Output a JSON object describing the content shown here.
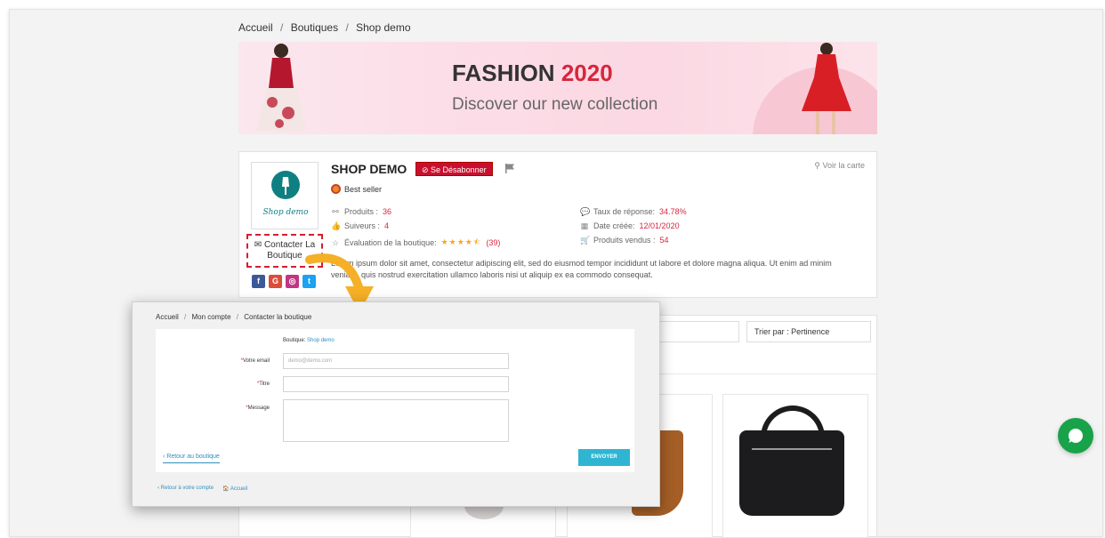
{
  "breadcrumb": {
    "items": [
      "Accueil",
      "Boutiques",
      "Shop demo"
    ],
    "separator": "/"
  },
  "banner": {
    "title": "FASHION",
    "year": "2020",
    "subtitle": "Discover our new collection"
  },
  "shop": {
    "name": "SHOP DEMO",
    "unsubscribe_label": "⊘ Se Désabonner",
    "map_link": "Voir la carte",
    "badge": "Best seller",
    "logo_text": "Shop demo",
    "contact_label_line1": "Contacter La",
    "contact_label_line2": "Boutique",
    "stats_left": [
      {
        "label": "Produits :",
        "value": "36"
      },
      {
        "label": "Suiveurs :",
        "value": "4"
      },
      {
        "label": "Évaluation de la boutique:",
        "value": "(39)"
      }
    ],
    "stats_right": [
      {
        "label": "Taux de réponse:",
        "value": "34.78%"
      },
      {
        "label": "Date créée:",
        "value": "12/01/2020"
      },
      {
        "label": "Produits vendus :",
        "value": "54"
      }
    ],
    "description": "Lorem ipsum dolor sit amet, consectetur adipiscing elit, sed do eiusmod tempor incididunt ut labore et dolore magna aliqua. Ut enim ad minim veniam, quis nostrud exercitation ullamco laboris nisi ut aliquip ex ea commodo consequat.",
    "socials": [
      "f",
      "G",
      "◎",
      "t"
    ]
  },
  "listing": {
    "sort_label": "Trier par : Pertinence"
  },
  "contact_form": {
    "breadcrumb": [
      "Accueil",
      "Mon compte",
      "Contacter la boutique"
    ],
    "shop_label": "Boutique:",
    "shop_value": "Shop demo",
    "email_label": "Votre email",
    "email_placeholder": "demo@demo.com",
    "title_label": "Titre",
    "message_label": "Message",
    "back_label": "‹ Retour au boutique",
    "send_label": "ENVOYER",
    "footer_account": "‹ Retour à votre compte",
    "footer_home": "Accueil"
  },
  "colors": {
    "accent_red": "#c8102e",
    "link_blue": "#2f8fc0",
    "button_cyan": "#2fb5d2",
    "chat_green": "#18a34a"
  }
}
